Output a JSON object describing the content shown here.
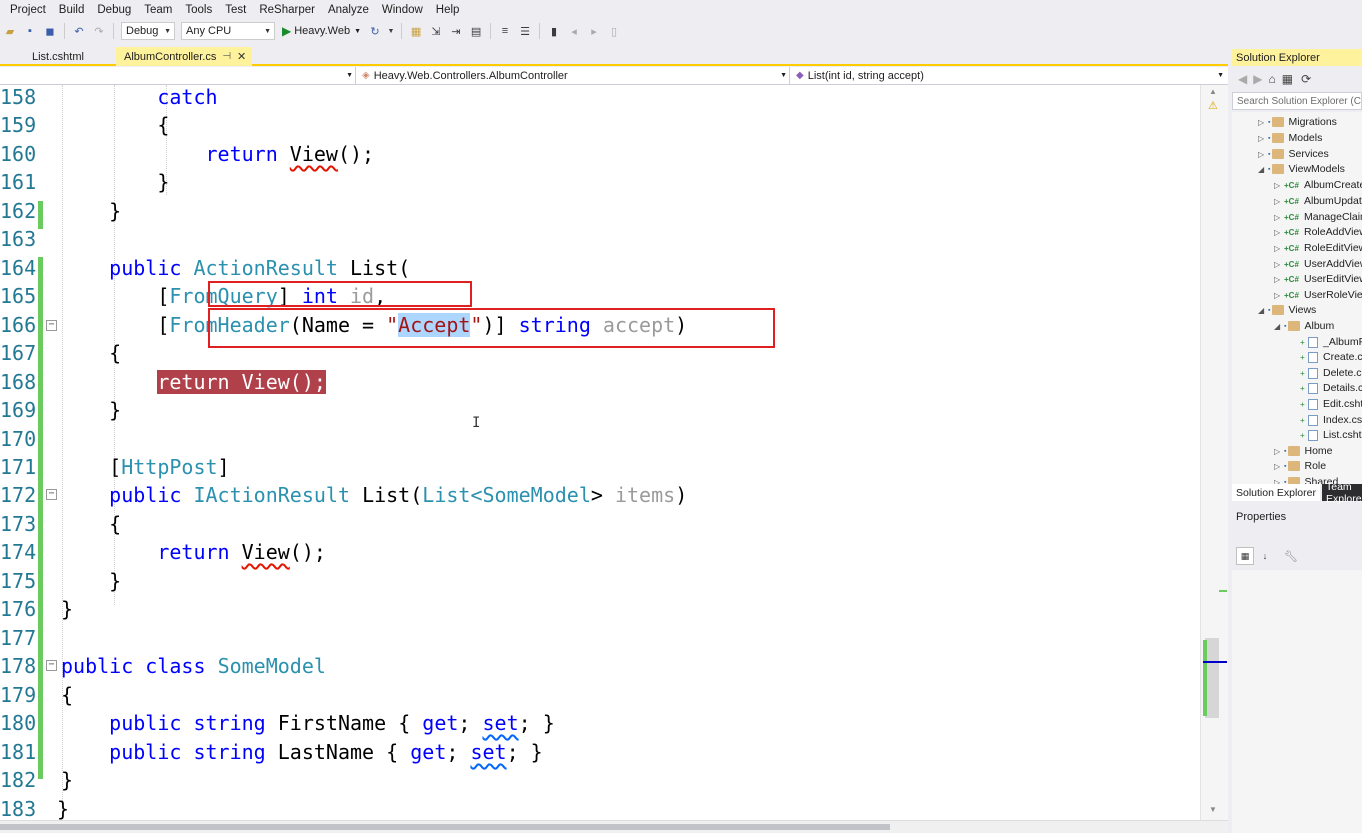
{
  "menu": [
    "Project",
    "Build",
    "Debug",
    "Team",
    "Tools",
    "Test",
    "ReSharper",
    "Analyze",
    "Window",
    "Help"
  ],
  "toolbar": {
    "config": "Debug",
    "platform": "Any CPU",
    "start_label": "Heavy.Web"
  },
  "tabs": {
    "inactive": "List.cshtml",
    "active": "AlbumController.cs",
    "pin_glyph": "⊣",
    "close_glyph": "✕"
  },
  "navbar": {
    "class_path": "Heavy.Web.Controllers.AlbumController",
    "member": "List(int id, string accept)"
  },
  "editor": {
    "lines": [
      {
        "n": "158"
      },
      {
        "n": "159"
      },
      {
        "n": "160"
      },
      {
        "n": "161"
      },
      {
        "n": "162"
      },
      {
        "n": "163"
      },
      {
        "n": "164"
      },
      {
        "n": "165"
      },
      {
        "n": "166"
      },
      {
        "n": "167"
      },
      {
        "n": "168"
      },
      {
        "n": "169"
      },
      {
        "n": "170"
      },
      {
        "n": "171"
      },
      {
        "n": "172"
      },
      {
        "n": "173"
      },
      {
        "n": "174"
      },
      {
        "n": "175"
      },
      {
        "n": "176"
      },
      {
        "n": "177"
      },
      {
        "n": "178"
      },
      {
        "n": "179"
      },
      {
        "n": "180"
      },
      {
        "n": "181"
      },
      {
        "n": "182"
      },
      {
        "n": "183"
      }
    ],
    "t": {
      "catch": "catch",
      "lbrace": "{",
      "rbrace": "}",
      "return": "return",
      "view": "View",
      "call_end": "();",
      "public": "public",
      "action_result": "ActionResult",
      "iaction_result": "IActionResult",
      "list": "List",
      "lparen": "(",
      "rparen": ")",
      "lbracket": "[",
      "rbracket": "]",
      "from_query": "FromQuery",
      "int": "int",
      "id": "id",
      "comma": ",",
      "from_header": "FromHeader",
      "name_eq": "(Name = ",
      "quote": "\"",
      "accept_str": "Accept",
      "close_attr": ")]",
      "string": "string",
      "accept_param": "accept",
      "http_post": "HttpPost",
      "list_generic_open": "List<",
      "some_model": "SomeModel",
      "generic_close": ">",
      "items": "items",
      "class": "class",
      "first_name": "FirstName",
      "last_name": "LastName",
      "get": "get",
      "set": "set",
      "semi": ";",
      "space": " "
    }
  },
  "solution_explorer": {
    "title": "Solution Explorer",
    "search_placeholder": "Search Solution Explorer (Ctrl+;)",
    "items": [
      {
        "label": "Migrations",
        "kind": "folder"
      },
      {
        "label": "Models",
        "kind": "folder"
      },
      {
        "label": "Services",
        "kind": "folder"
      },
      {
        "label": "ViewModels",
        "kind": "folder"
      },
      {
        "label": "AlbumCreateViewModel.cs",
        "kind": "cs"
      },
      {
        "label": "AlbumUpdateViewModel.cs",
        "kind": "cs"
      },
      {
        "label": "ManageClaimsViewModel.cs",
        "kind": "cs"
      },
      {
        "label": "RoleAddViewModel.cs",
        "kind": "cs"
      },
      {
        "label": "RoleEditViewModel.cs",
        "kind": "cs"
      },
      {
        "label": "UserAddViewModel.cs",
        "kind": "cs"
      },
      {
        "label": "UserEditViewModel.cs",
        "kind": "cs"
      },
      {
        "label": "UserRoleViewModel.cs",
        "kind": "cs"
      },
      {
        "label": "Views",
        "kind": "folder"
      },
      {
        "label": "Album",
        "kind": "folder"
      },
      {
        "label": "_AlbumForm.cshtml",
        "kind": "file"
      },
      {
        "label": "Create.cshtml",
        "kind": "file"
      },
      {
        "label": "Delete.cshtml",
        "kind": "file"
      },
      {
        "label": "Details.cshtml",
        "kind": "file"
      },
      {
        "label": "Edit.cshtml",
        "kind": "file"
      },
      {
        "label": "Index.cshtml",
        "kind": "file"
      },
      {
        "label": "List.cshtml",
        "kind": "file"
      },
      {
        "label": "Home",
        "kind": "folder"
      },
      {
        "label": "Role",
        "kind": "folder"
      },
      {
        "label": "Shared",
        "kind": "folder"
      }
    ],
    "bottom_tabs": [
      "Solution Explorer",
      "Team Explorer"
    ]
  },
  "properties": {
    "title": "Properties"
  },
  "colors": {
    "accent_tab": "#fff29d",
    "keyword": "#0000ff",
    "type": "#2b91af",
    "breakpoint": "#b0414b",
    "annotation_box": "#e02020"
  }
}
